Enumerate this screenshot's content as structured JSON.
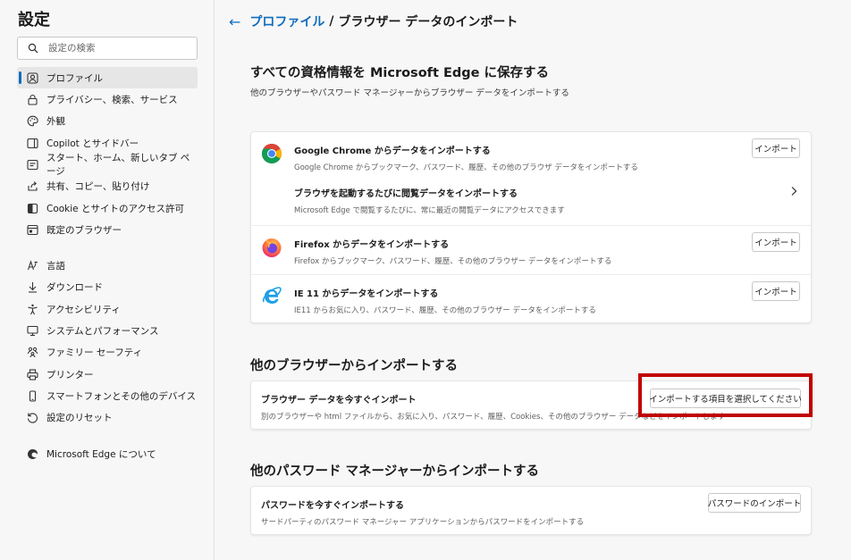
{
  "sidebar": {
    "title": "設定",
    "search_placeholder": "設定の検索",
    "items": [
      {
        "label": "プロファイル",
        "icon": "profile-icon"
      },
      {
        "label": "プライバシー、検索、サービス",
        "icon": "lock-icon"
      },
      {
        "label": "外観",
        "icon": "palette-icon"
      },
      {
        "label": "Copilot とサイドバー",
        "icon": "sidebar-icon"
      },
      {
        "label": "スタート、ホーム、新しいタブ ページ",
        "icon": "home-grid-icon"
      },
      {
        "label": "共有、コピー、貼り付け",
        "icon": "share-icon"
      },
      {
        "label": "Cookie とサイトのアクセス許可",
        "icon": "cookie-icon"
      },
      {
        "label": "既定のブラウザー",
        "icon": "browser-icon"
      },
      {
        "label": "言語",
        "icon": "language-icon"
      },
      {
        "label": "ダウンロード",
        "icon": "download-icon"
      },
      {
        "label": "アクセシビリティ",
        "icon": "accessibility-icon"
      },
      {
        "label": "システムとパフォーマンス",
        "icon": "system-icon"
      },
      {
        "label": "ファミリー セーフティ",
        "icon": "family-icon"
      },
      {
        "label": "プリンター",
        "icon": "printer-icon"
      },
      {
        "label": "スマートフォンとその他のデバイス",
        "icon": "phone-icon"
      },
      {
        "label": "設定のリセット",
        "icon": "reset-icon"
      },
      {
        "label": "Microsoft Edge について",
        "icon": "edge-icon"
      }
    ]
  },
  "breadcrumb": {
    "back_icon": "back-arrow-icon",
    "parent": "プロファイル",
    "separator": "/",
    "current": "ブラウザー データのインポート"
  },
  "section1": {
    "title": "すべての資格情報を Microsoft Edge に保存する",
    "subtitle": "他のブラウザーやパスワード マネージャーからブラウザー データをインポートする",
    "chrome": {
      "title": "Google Chrome からデータをインポートする",
      "desc": "Google Chrome からブックマーク、パスワード、履歴、その他のブラウザ データをインポートする",
      "button": "インポート",
      "icon": "chrome-icon"
    },
    "chrome_auto": {
      "title": "ブラウザを起動するたびに閲覧データをインポートする",
      "desc": "Microsoft Edge で閲覧するたびに、常に最近の閲覧データにアクセスできます",
      "icon": "chevron-right-icon"
    },
    "firefox": {
      "title": "Firefox からデータをインポートする",
      "desc": "Firefox からブックマーク、パスワード、履歴、その他のブラウザー データをインポートする",
      "button": "インポート",
      "icon": "firefox-icon"
    },
    "ie": {
      "title": "IE 11 からデータをインポートする",
      "desc": "IE11 からお気に入り、パスワード、履歴、その他のブラウザー データをインポートする",
      "button": "インポート",
      "icon": "ie-icon"
    }
  },
  "section2": {
    "title": "他のブラウザーからインポートする",
    "row_title": "ブラウザー データを今すぐインポート",
    "row_desc": "別のブラウザーや html ファイルから、お気に入り、パスワード、履歴、Cookies、その他のブラウザー データなどをインポートします",
    "button": "インポートする項目を選択してください"
  },
  "section3": {
    "title": "他のパスワード マネージャーからインポートする",
    "row_title": "パスワードを今すぐインポートする",
    "row_desc": "サードパーティのパスワード マネージャー アプリケーションからパスワードをインポートする",
    "button": "パスワードのインポート"
  },
  "colors": {
    "accent": "#0f6cbd",
    "highlight": "#c00000",
    "background": "#f7f7f7",
    "card": "#ffffff"
  }
}
